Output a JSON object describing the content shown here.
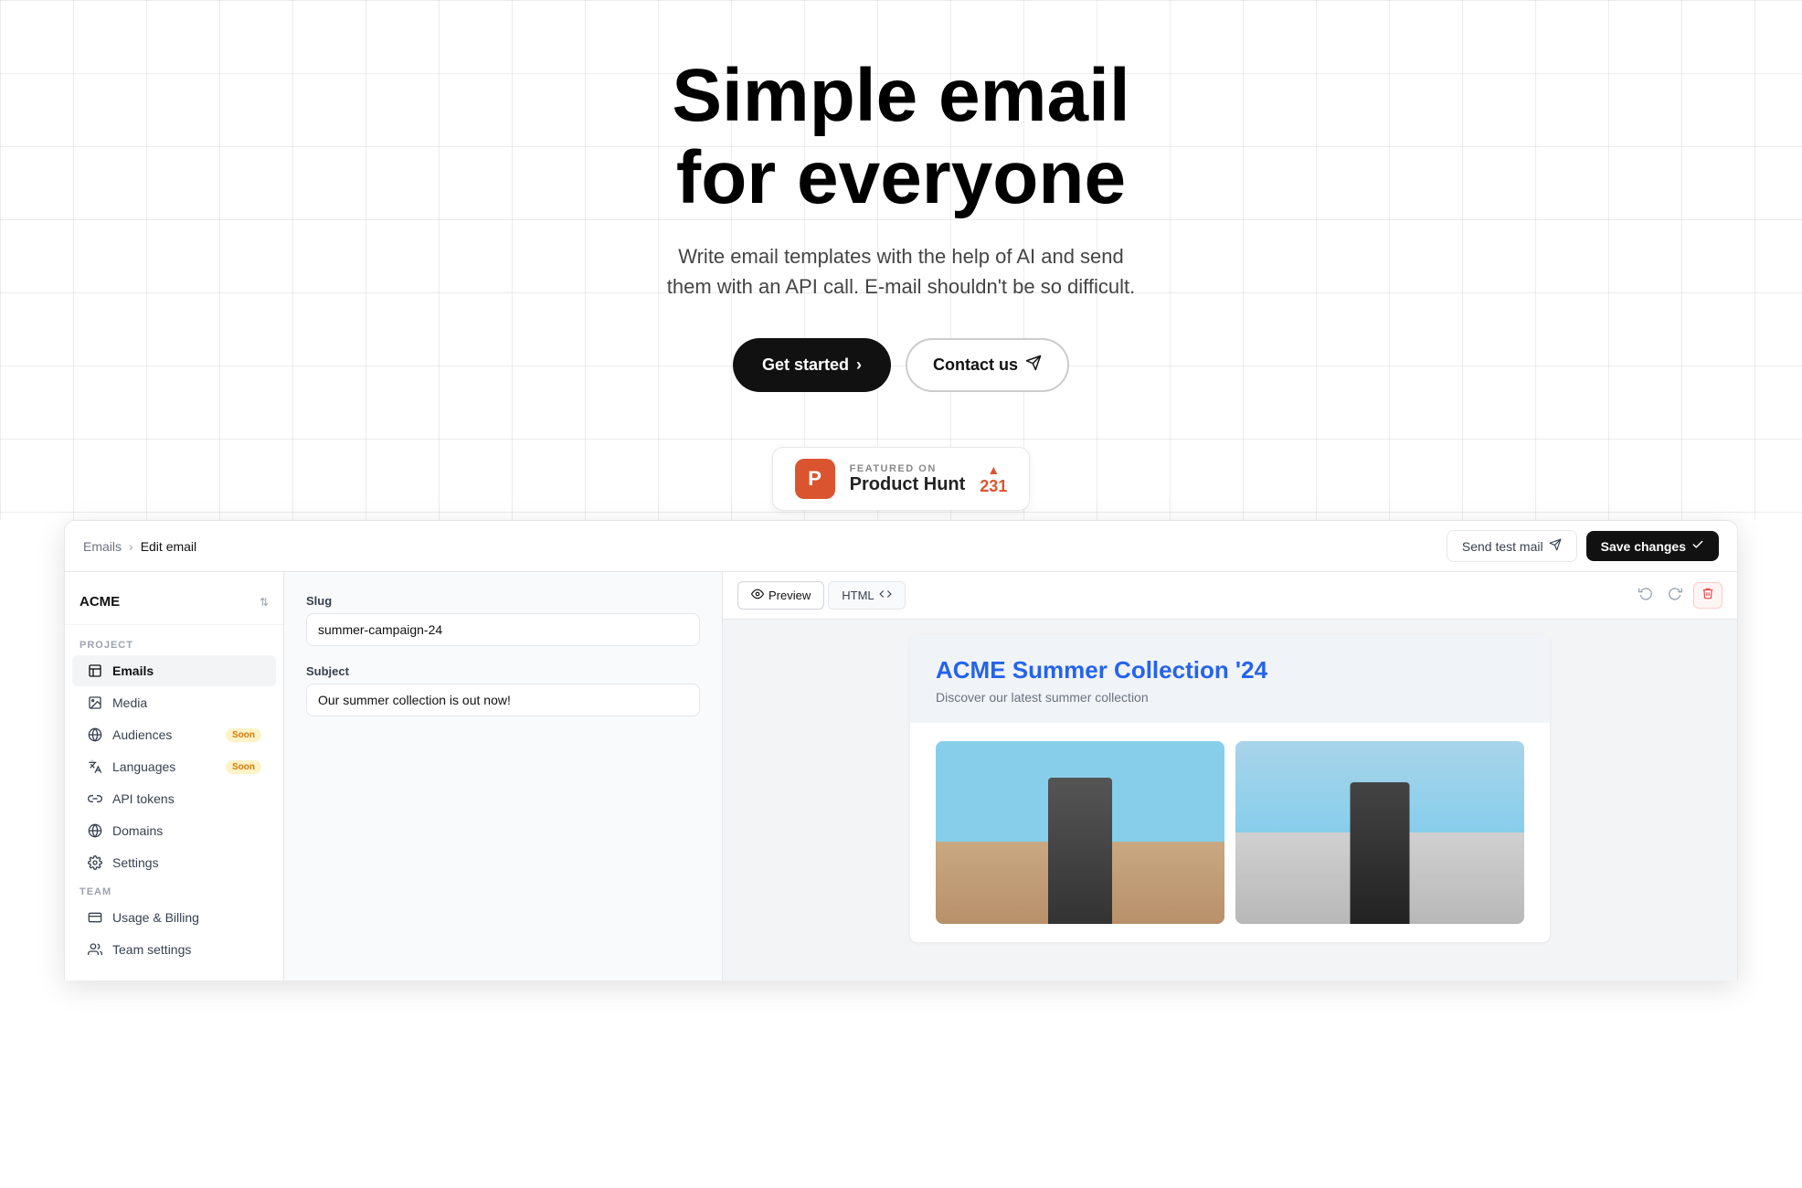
{
  "hero": {
    "title_line1": "Simple email",
    "title_line2": "for everyone",
    "subtitle": "Write email templates with the help of AI and send them with an API call. E-mail shouldn't be so difficult.",
    "btn_get_started": "Get started",
    "btn_contact_us": "Contact us"
  },
  "product_hunt": {
    "featured_label": "FEATURED ON",
    "product_name": "Product Hunt",
    "votes": "231"
  },
  "app": {
    "breadcrumb_parent": "Emails",
    "breadcrumb_current": "Edit email",
    "send_test_label": "Send test mail",
    "save_label": "Save changes"
  },
  "sidebar": {
    "workspace": "ACME",
    "project_label": "PROJECT",
    "team_label": "TEAM",
    "items": [
      {
        "id": "emails",
        "label": "Emails",
        "active": true
      },
      {
        "id": "media",
        "label": "Media",
        "active": false
      },
      {
        "id": "audiences",
        "label": "Audiences",
        "badge": "Soon",
        "active": false
      },
      {
        "id": "languages",
        "label": "Languages",
        "badge": "Soon",
        "active": false
      },
      {
        "id": "api-tokens",
        "label": "API tokens",
        "active": false
      },
      {
        "id": "domains",
        "label": "Domains",
        "active": false
      },
      {
        "id": "settings",
        "label": "Settings",
        "active": false
      }
    ],
    "team_items": [
      {
        "id": "usage-billing",
        "label": "Usage & Billing",
        "active": false
      },
      {
        "id": "team-settings",
        "label": "Team settings",
        "active": false
      }
    ]
  },
  "form": {
    "slug_label": "Slug",
    "slug_value": "summer-campaign-24",
    "subject_label": "Subject",
    "subject_value": "Our summer collection is out now!"
  },
  "preview": {
    "tab_preview": "Preview",
    "tab_html": "HTML",
    "email_title": "ACME Summer Collection '24",
    "email_subtitle": "Discover our latest summer collection"
  }
}
